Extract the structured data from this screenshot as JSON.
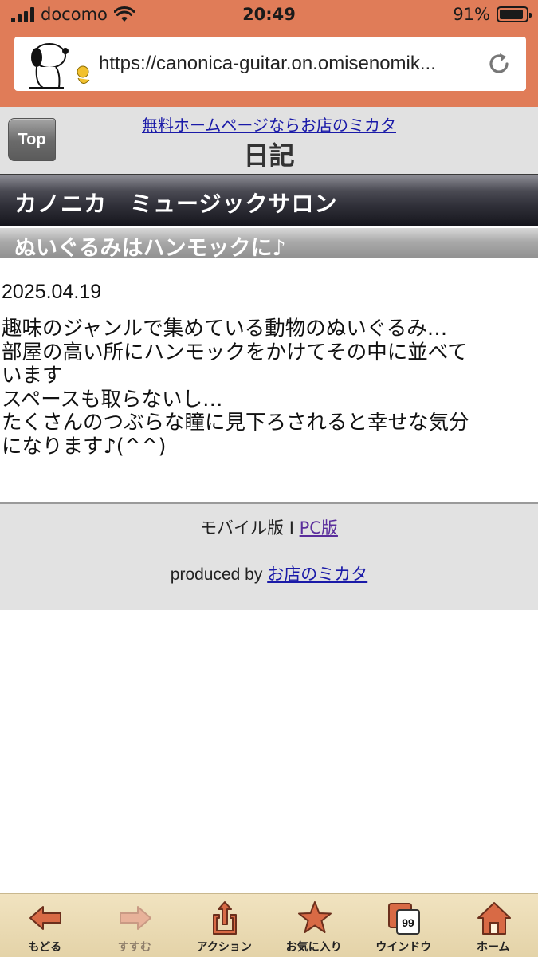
{
  "status_bar": {
    "carrier": "docomo",
    "time": "20:49",
    "battery_percent": "91%",
    "battery_level": 0.91,
    "signal_bars": 4
  },
  "address_bar": {
    "url": "https://canonica-guitar.on.omisenomik..."
  },
  "header": {
    "top_button_label": "Top",
    "promo_link": "無料ホームページならお店のミカタ",
    "page_title": "日記"
  },
  "shop": {
    "name": "カノニカ　ミュージックサロン"
  },
  "entry": {
    "title": "ぬいぐるみはハンモックに♪",
    "date": "2025.04.19",
    "body_lines": [
      "趣味のジャンルで集めている動物のぬいぐるみ…",
      "部屋の高い所にハンモックをかけてその中に並べて",
      "います",
      "スペースも取らないし…",
      "たくさんのつぶらな瞳に見下ろされると幸せな気分",
      "になります♪(^^)"
    ]
  },
  "footer": {
    "mobile_label": "モバイル版 I ",
    "pc_link": "PC版",
    "produced_by": "produced by ",
    "produced_link": "お店のミカタ"
  },
  "toolbar": {
    "items": [
      {
        "label": "もどる",
        "icon": "back-arrow-icon",
        "enabled": true
      },
      {
        "label": "すすむ",
        "icon": "forward-arrow-icon",
        "enabled": false
      },
      {
        "label": "アクション",
        "icon": "share-icon",
        "enabled": true
      },
      {
        "label": "お気に入り",
        "icon": "star-icon",
        "enabled": true
      },
      {
        "label": "ウインドウ",
        "icon": "windows-icon",
        "enabled": true,
        "badge": "99"
      },
      {
        "label": "ホーム",
        "icon": "home-icon",
        "enabled": true
      }
    ]
  },
  "colors": {
    "chrome_orange": "#e07c58",
    "toolbar_icon": "#d86a45",
    "link_blue": "#1a1aa8",
    "link_visited": "#5a2d9c"
  }
}
